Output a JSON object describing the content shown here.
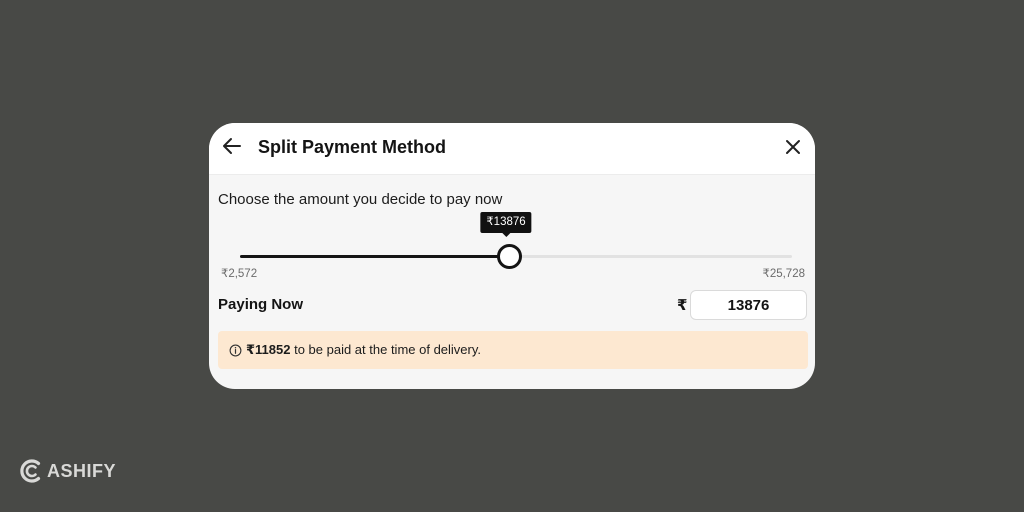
{
  "dialog": {
    "title": "Split Payment Method",
    "prompt": "Choose the amount you decide to pay now",
    "slider": {
      "min_label": "₹2,572",
      "max_label": "₹25,728",
      "min": 2572,
      "max": 25728,
      "value": 13876,
      "tooltip": "₹13876"
    },
    "paying_now": {
      "label": "Paying Now",
      "currency_symbol": "₹",
      "value": "13876"
    },
    "notice": {
      "amount": "₹11852",
      "text": " to be paid at the time of delivery."
    }
  },
  "branding": {
    "logo_text": "ASHIFY"
  },
  "icons": {
    "back": "arrow-left-icon",
    "close": "close-icon",
    "info": "info-icon",
    "logo": "cashify-logo-icon"
  },
  "colors": {
    "background": "#484946",
    "card": "#f6f6f6",
    "slider_fill": "#141414",
    "notice_bg": "#fde8d1"
  }
}
